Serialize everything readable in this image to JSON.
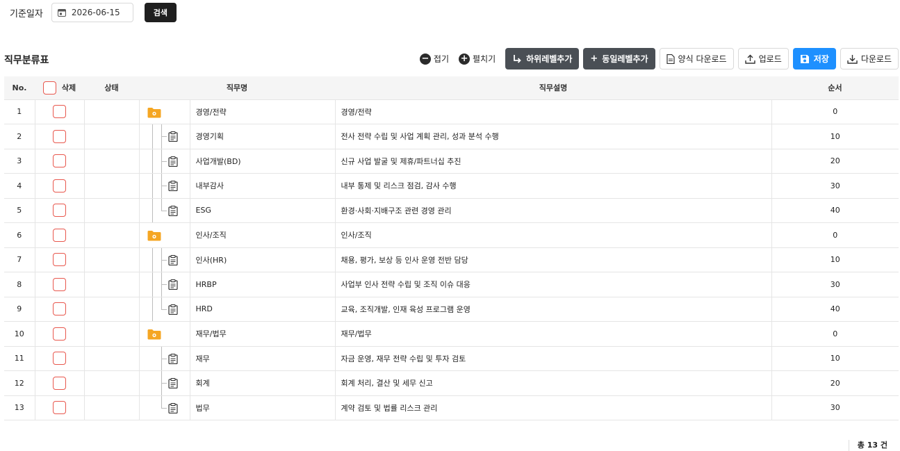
{
  "search": {
    "label": "기준일자",
    "date_value": "2026-06-15",
    "search_button": "검색"
  },
  "section": {
    "title": "직무분류표"
  },
  "toolbar": {
    "collapse": "접기",
    "expand": "펼치기",
    "add_child": "하위레벨추가",
    "add_sibling": "동일레벨추가",
    "template_download": "양식 다운로드",
    "upload": "업로드",
    "save": "저장",
    "download": "다운로드"
  },
  "colors": {
    "accent_blue": "#1e90ff",
    "dark_button": "#4a4f55",
    "folder": "#f5a623",
    "checkbox_border": "#e8574d"
  },
  "table": {
    "headers": {
      "no": "No.",
      "delete": "삭제",
      "status": "상태",
      "job_name": "직무명",
      "job_desc": "직무설명",
      "order": "순서"
    },
    "rows": [
      {
        "no": "1",
        "type": "folder",
        "name": "경영/전략",
        "desc": "경영/전략",
        "order": "0"
      },
      {
        "no": "2",
        "type": "child",
        "name": "경영기획",
        "desc": "전사 전략 수립 및 사업 계획 관리, 성과 분석 수행",
        "order": "10"
      },
      {
        "no": "3",
        "type": "child",
        "name": "사업개발(BD)",
        "desc": "신규 사업 발굴 및 제휴/파트너십 추진",
        "order": "20"
      },
      {
        "no": "4",
        "type": "child",
        "name": "내부감사",
        "desc": "내부 통제 및 리스크 점검, 감사 수행",
        "order": "30"
      },
      {
        "no": "5",
        "type": "child-last",
        "name": "ESG",
        "desc": "환경·사회·지배구조 관련 경영 관리",
        "order": "40"
      },
      {
        "no": "6",
        "type": "folder",
        "name": "인사/조직",
        "desc": "인사/조직",
        "order": "0"
      },
      {
        "no": "7",
        "type": "child",
        "name": "인사(HR)",
        "desc": "채용, 평가, 보상 등 인사 운영 전반 담당",
        "order": "10"
      },
      {
        "no": "8",
        "type": "child",
        "name": "HRBP",
        "desc": "사업부 인사 전략 수립 및 조직 이슈 대응",
        "order": "30"
      },
      {
        "no": "9",
        "type": "child-last",
        "name": "HRD",
        "desc": "교육, 조직개발, 인재 육성 프로그램 운영",
        "order": "40"
      },
      {
        "no": "10",
        "type": "folder-last",
        "name": "재무/법무",
        "desc": "재무/법무",
        "order": "0"
      },
      {
        "no": "11",
        "type": "child-nov",
        "name": "재무",
        "desc": "자금 운영, 재무 전략 수립 및 투자 검토",
        "order": "10"
      },
      {
        "no": "12",
        "type": "child-nov",
        "name": "회계",
        "desc": "회계 처리, 결산 및 세무 신고",
        "order": "20"
      },
      {
        "no": "13",
        "type": "child-nov-last",
        "name": "법무",
        "desc": "계약 검토 및 법률 리스크 관리",
        "order": "30"
      }
    ]
  },
  "footer": {
    "total": "총 13 건"
  }
}
